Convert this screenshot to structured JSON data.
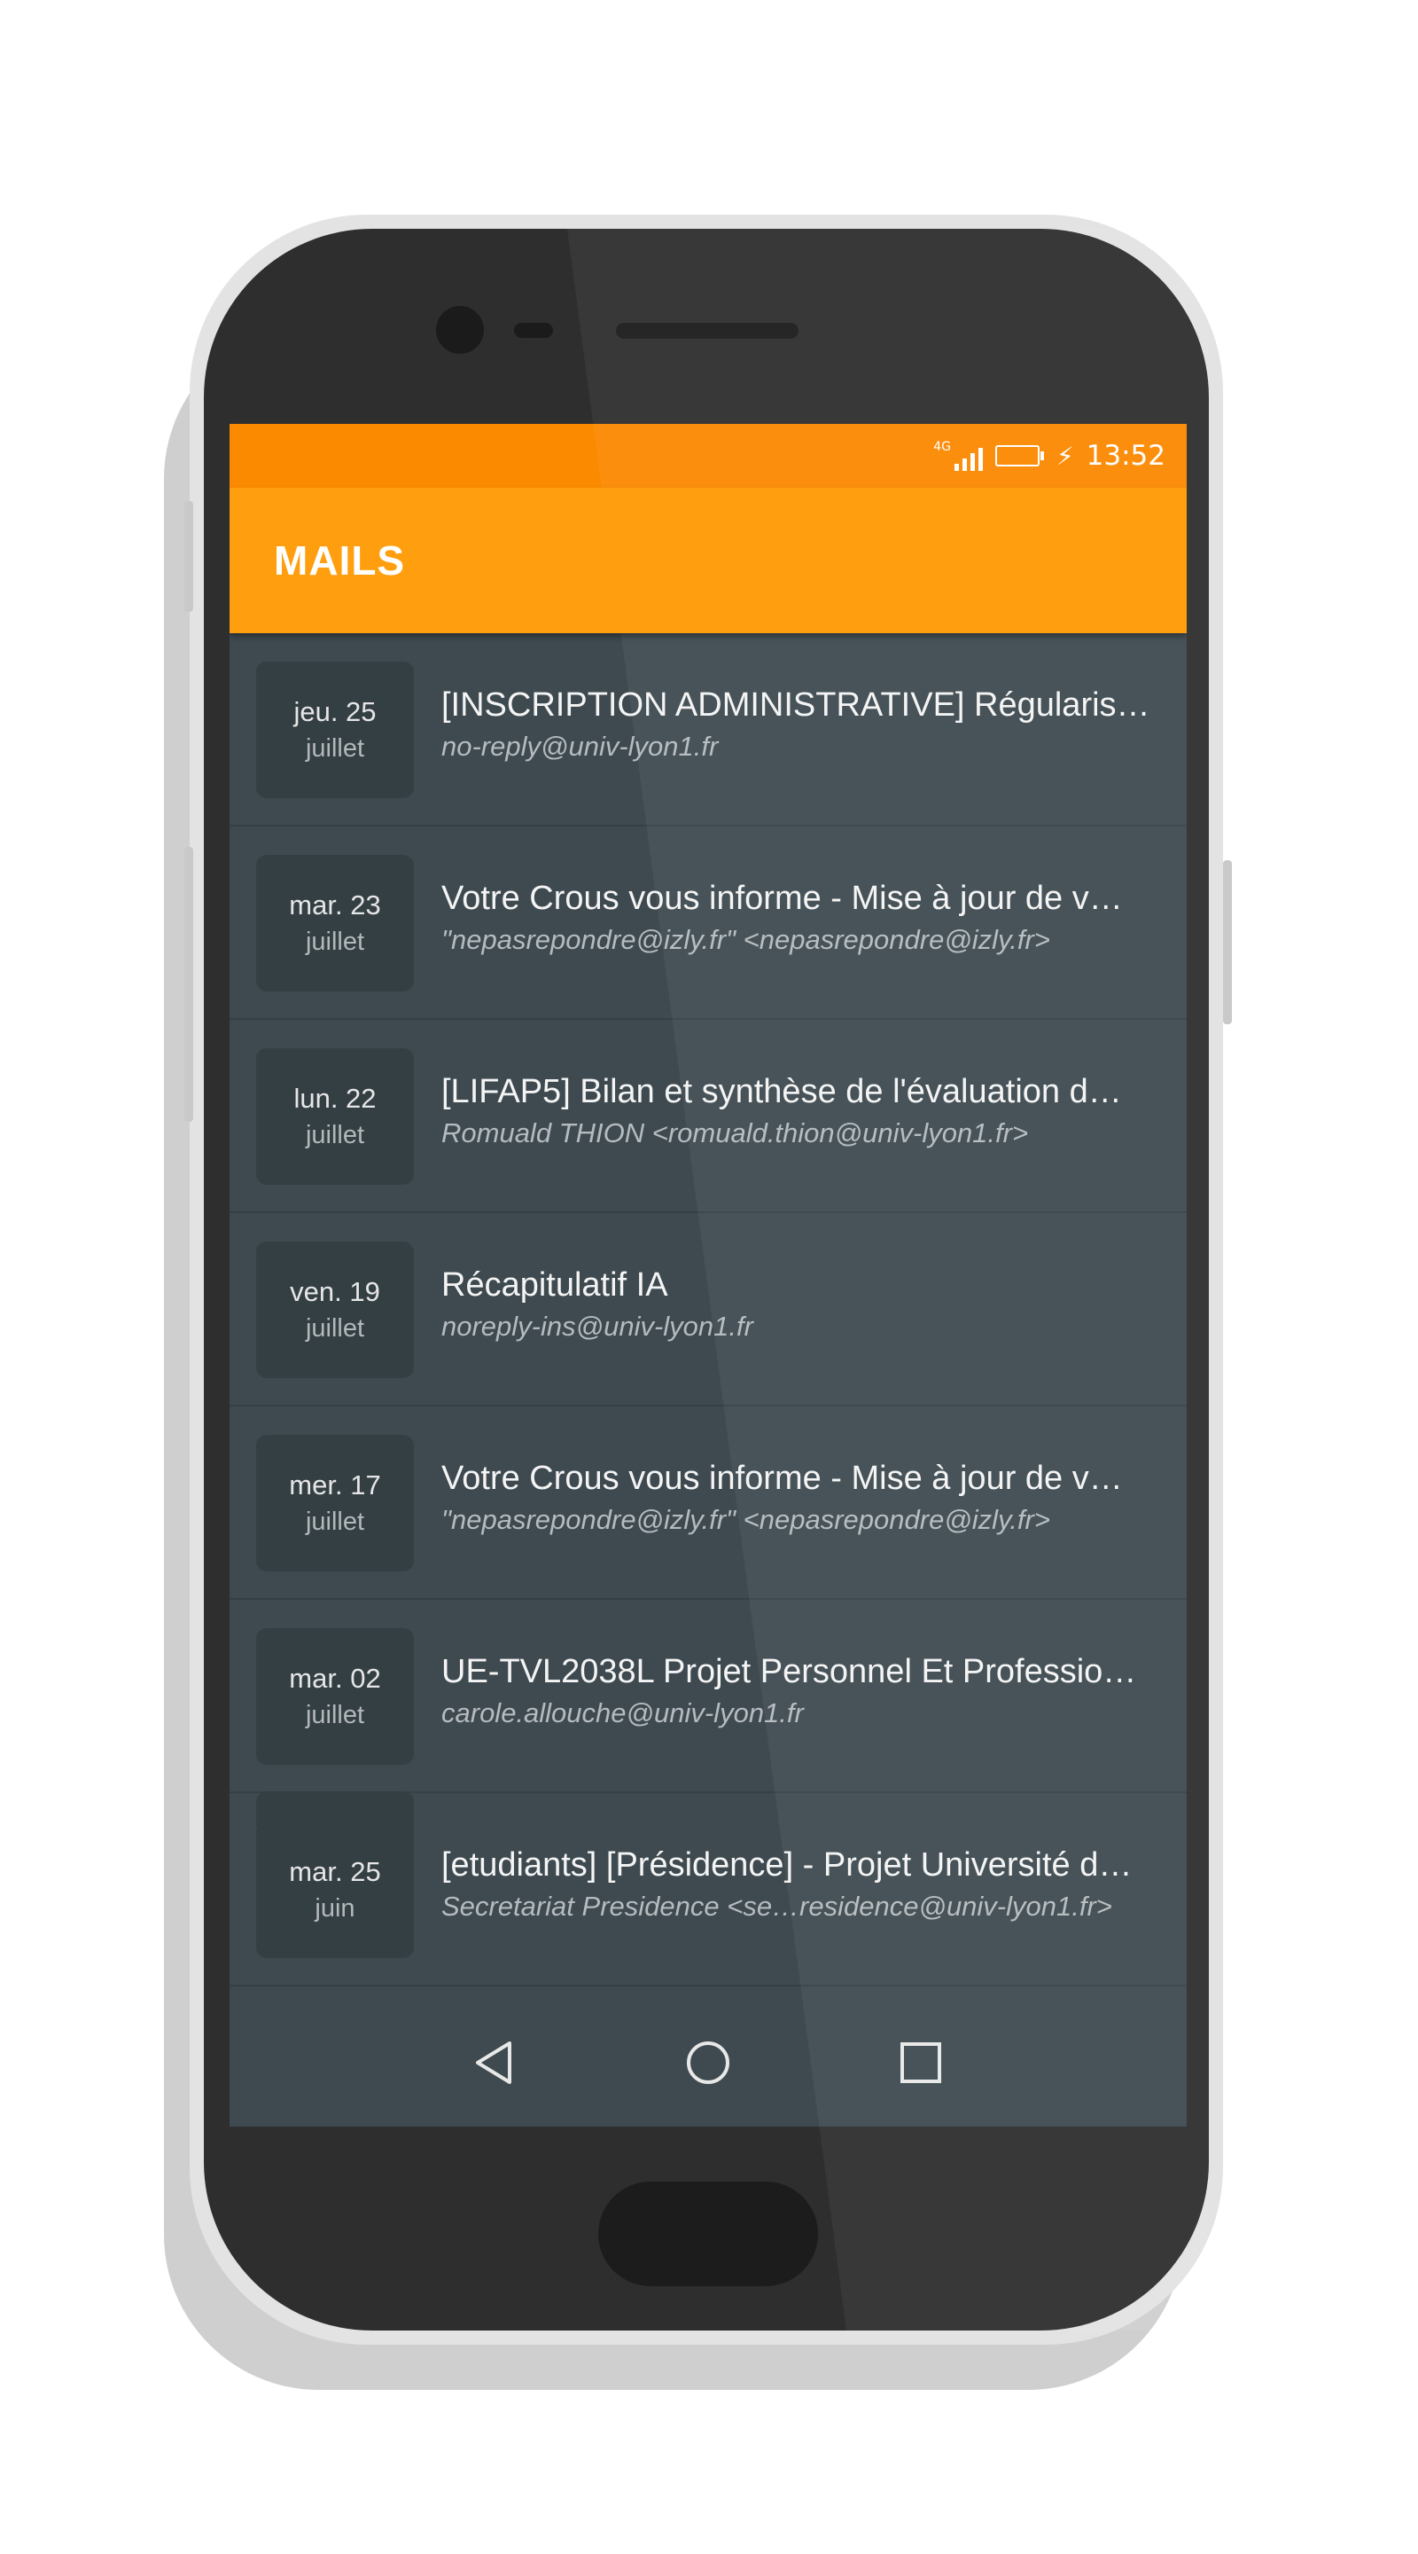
{
  "status_bar": {
    "network_label": "4G",
    "time": "13:52",
    "icons": [
      "signal-icon",
      "battery-icon",
      "charging-bolt-icon"
    ]
  },
  "app_bar": {
    "title": "MAILS"
  },
  "mails": [
    {
      "day": "jeu. 25",
      "month": "juillet",
      "subject": "[INSCRIPTION ADMINISTRATIVE] Régularis…",
      "sender": "no-reply@univ-lyon1.fr"
    },
    {
      "day": "mar. 23",
      "month": "juillet",
      "subject": "Votre Crous vous informe - Mise à jour de v…",
      "sender": "\"nepasrepondre@izly.fr\" <nepasrepondre@izly.fr>"
    },
    {
      "day": "lun. 22",
      "month": "juillet",
      "subject": "[LIFAP5] Bilan et synthèse de l'évaluation d…",
      "sender": "Romuald THION <romuald.thion@univ-lyon1.fr>"
    },
    {
      "day": "ven. 19",
      "month": "juillet",
      "subject": "Récapitulatif IA",
      "sender": "noreply-ins@univ-lyon1.fr"
    },
    {
      "day": "mer. 17",
      "month": "juillet",
      "subject": "Votre Crous vous informe - Mise à jour de v…",
      "sender": "\"nepasrepondre@izly.fr\" <nepasrepondre@izly.fr>"
    },
    {
      "day": "mar. 02",
      "month": "juillet",
      "subject": "UE-TVL2038L Projet Personnel Et Professio…",
      "sender": "carole.allouche@univ-lyon1.fr"
    },
    {
      "day": "mar. 25",
      "month": "juin",
      "subject": "[etudiants] [Présidence] - Projet Université d…",
      "sender": "Secretariat Presidence <se…residence@univ-lyon1.fr>"
    }
  ],
  "nav_bar": {
    "icons": [
      "back-icon",
      "home-icon",
      "recent-apps-icon"
    ]
  },
  "colors": {
    "status_bar": "#fb8a00",
    "app_bar": "#ff9e0e",
    "list_background": "#3e4a50",
    "date_box": "#343f44"
  }
}
